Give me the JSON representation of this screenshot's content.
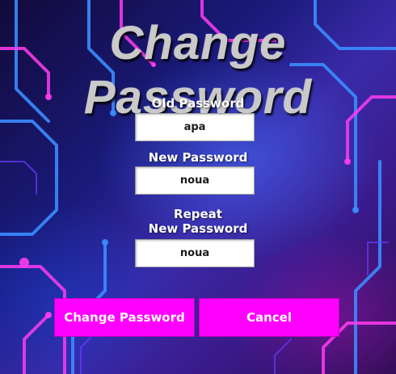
{
  "window": {
    "title": "Change Password"
  },
  "form": {
    "old_password": {
      "label": "Old Password",
      "value": "apa"
    },
    "new_password": {
      "label": "New Password",
      "value": "noua"
    },
    "repeat_password": {
      "label_line1": "Repeat",
      "label_line2": "New Password",
      "value": "noua"
    }
  },
  "buttons": {
    "change_label": "Change Password",
    "cancel_label": "Cancel"
  },
  "colors": {
    "button_bg": "#ff00ff",
    "circuit_pink": "#ff3cf0",
    "circuit_blue": "#3a8cff"
  }
}
